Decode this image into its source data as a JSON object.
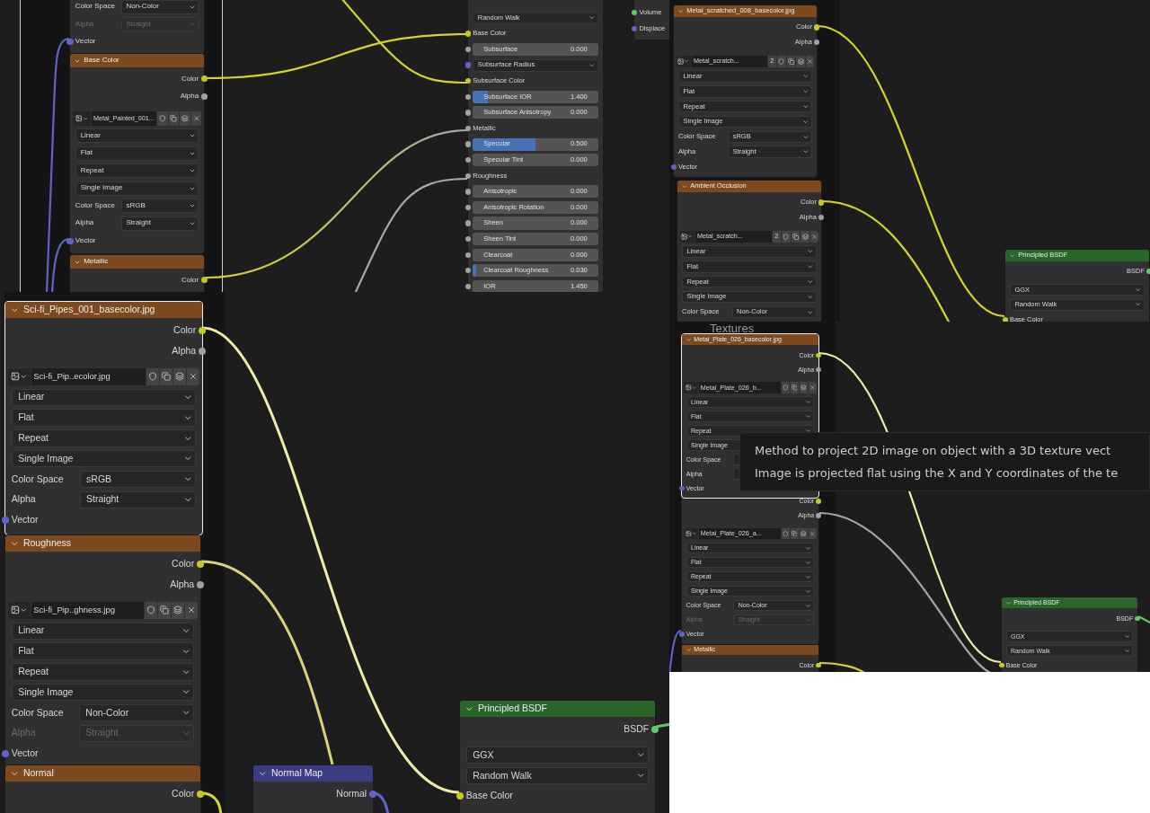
{
  "panels": [
    {
      "nodes": [
        {
          "kind": "texture",
          "selected": false,
          "rows": [
            {
              "kind": "prop",
              "label": "Color Space",
              "value": "Non-Color",
              "disabled": false
            },
            {
              "kind": "prop",
              "label": "Alpha",
              "value": "Straight",
              "disabled": true
            },
            {
              "kind": "input",
              "label": "Vector",
              "color": "#6363c7"
            }
          ]
        },
        {
          "title": "Base Color",
          "kind": "texture",
          "selected": false,
          "rows": [
            {
              "kind": "output",
              "label": "Color",
              "color": "#c7c729"
            },
            {
              "kind": "output",
              "label": "Alpha",
              "color": "#a1a1a1"
            },
            {
              "kind": "image",
              "file": "Metal_Painted_001..."
            },
            {
              "kind": "select",
              "value": "Linear"
            },
            {
              "kind": "select",
              "value": "Flat"
            },
            {
              "kind": "select",
              "value": "Repeat"
            },
            {
              "kind": "select",
              "value": "Single Image"
            },
            {
              "kind": "prop",
              "label": "Color Space",
              "value": "sRGB",
              "disabled": false
            },
            {
              "kind": "prop",
              "label": "Alpha",
              "value": "Straight",
              "disabled": false
            },
            {
              "kind": "input",
              "label": "Vector",
              "color": "#6363c7"
            }
          ]
        },
        {
          "title": "Metallic",
          "kind": "texture",
          "selected": false,
          "rows": [
            {
              "kind": "output",
              "label": "Color",
              "color": "#c7c729"
            }
          ]
        },
        {
          "kind": "shader",
          "selected": false,
          "rows": [
            {
              "kind": "select",
              "value": "Random Walk"
            },
            {
              "kind": "input",
              "label": "Base Color",
              "color": "#c7c729"
            },
            {
              "kind": "slider",
              "label": "Subsurface",
              "value": "0.000",
              "level": 0,
              "color": "#a1a1a1"
            },
            {
              "kind": "select",
              "value": "Subsurface Radius",
              "color": "#6363c7"
            },
            {
              "kind": "input",
              "label": "Subsurface Color",
              "color": "#c7c729"
            },
            {
              "kind": "slider",
              "label": "Subsurface IOR",
              "value": "1.400",
              "level": 0.12,
              "color": "#a1a1a1"
            },
            {
              "kind": "slider",
              "label": "Subsurface Anisotropy",
              "value": "0.000",
              "level": 0,
              "color": "#a1a1a1"
            },
            {
              "kind": "input",
              "label": "Metallic",
              "color": "#a1a1a1"
            },
            {
              "kind": "slider",
              "label": "Specular",
              "value": "0.500",
              "level": 0.5,
              "color": "#a1a1a1"
            },
            {
              "kind": "slider",
              "label": "Specular Tint",
              "value": "0.000",
              "level": 0,
              "color": "#a1a1a1"
            },
            {
              "kind": "input",
              "label": "Roughness",
              "color": "#a1a1a1"
            },
            {
              "kind": "slider",
              "label": "Anisotropic",
              "value": "0.000",
              "level": 0,
              "color": "#a1a1a1"
            },
            {
              "kind": "slider",
              "label": "Anisotropic Rotation",
              "value": "0.000",
              "level": 0,
              "color": "#a1a1a1"
            },
            {
              "kind": "slider",
              "label": "Sheen",
              "value": "0.000",
              "level": 0,
              "color": "#a1a1a1"
            },
            {
              "kind": "slider",
              "label": "Sheen Tint",
              "value": "0.000",
              "level": 0,
              "color": "#a1a1a1"
            },
            {
              "kind": "slider",
              "label": "Clearcoat",
              "value": "0.000",
              "level": 0,
              "color": "#a1a1a1"
            },
            {
              "kind": "slider",
              "label": "Clearcoat Roughness",
              "value": "0.030",
              "level": 0.03,
              "color": "#a1a1a1"
            },
            {
              "kind": "slider",
              "label": "IOR",
              "value": "1.450",
              "level": 0,
              "color": "#a1a1a1"
            }
          ]
        },
        {
          "kind": "output",
          "selected": false,
          "rows": [
            {
              "kind": "input",
              "label": "Volume",
              "color": "#63c763"
            },
            {
              "kind": "input",
              "label": "Displace",
              "color": "#6363c7"
            }
          ]
        }
      ]
    },
    {
      "nodes": [
        {
          "title": "Metal_scratched_008_basecolor.jpg",
          "kind": "texture",
          "selected": false,
          "rows": [
            {
              "kind": "output",
              "label": "Color",
              "color": "#c7c729"
            },
            {
              "kind": "output",
              "label": "Alpha",
              "color": "#a1a1a1"
            },
            {
              "kind": "image",
              "file": "Metal_scratch...",
              "users": "2"
            },
            {
              "kind": "select",
              "value": "Linear"
            },
            {
              "kind": "select",
              "value": "Flat"
            },
            {
              "kind": "select",
              "value": "Repeat"
            },
            {
              "kind": "select",
              "value": "Single Image"
            },
            {
              "kind": "prop",
              "label": "Color Space",
              "value": "sRGB",
              "disabled": false
            },
            {
              "kind": "prop",
              "label": "Alpha",
              "value": "Straight",
              "disabled": false
            },
            {
              "kind": "input",
              "label": "Vector",
              "color": "#6363c7"
            }
          ]
        },
        {
          "title": "Ambient Occlusion",
          "kind": "texture",
          "selected": false,
          "rows": [
            {
              "kind": "output",
              "label": "Color",
              "color": "#c7c729"
            },
            {
              "kind": "output",
              "label": "Alpha",
              "color": "#a1a1a1"
            },
            {
              "kind": "image",
              "file": "Metal_scratch...",
              "users": "2"
            },
            {
              "kind": "select",
              "value": "Linear"
            },
            {
              "kind": "select",
              "value": "Flat"
            },
            {
              "kind": "select",
              "value": "Repeat"
            },
            {
              "kind": "select",
              "value": "Single Image"
            },
            {
              "kind": "prop",
              "label": "Color Space",
              "value": "Non-Color",
              "disabled": false
            }
          ]
        },
        {
          "title": "Principled BSDF",
          "kind": "shader",
          "selected": false,
          "rows": [
            {
              "kind": "output",
              "label": "BSDF",
              "color": "#63c763"
            },
            {
              "kind": "select",
              "value": "GGX"
            },
            {
              "kind": "select",
              "value": "Random Walk"
            },
            {
              "kind": "input",
              "label": "Base Color",
              "color": "#c7c729"
            }
          ]
        }
      ]
    },
    {
      "nodes": [
        {
          "title": "Sci-fi_Pipes_001_basecolor.jpg",
          "kind": "texture",
          "selected": true,
          "rows": [
            {
              "kind": "output",
              "label": "Color",
              "color": "#c7c729"
            },
            {
              "kind": "output",
              "label": "Alpha",
              "color": "#a1a1a1"
            },
            {
              "kind": "image",
              "file": "Sci-fi_Pip..ecolor.jpg"
            },
            {
              "kind": "select",
              "value": "Linear"
            },
            {
              "kind": "select",
              "value": "Flat"
            },
            {
              "kind": "select",
              "value": "Repeat"
            },
            {
              "kind": "select",
              "value": "Single Image"
            },
            {
              "kind": "prop",
              "label": "Color Space",
              "value": "sRGB",
              "disabled": false
            },
            {
              "kind": "prop",
              "label": "Alpha",
              "value": "Straight",
              "disabled": false
            },
            {
              "kind": "input",
              "label": "Vector",
              "color": "#6363c7"
            }
          ]
        },
        {
          "title": "Roughness",
          "kind": "texture",
          "selected": false,
          "rows": [
            {
              "kind": "output",
              "label": "Color",
              "color": "#c7c729"
            },
            {
              "kind": "output",
              "label": "Alpha",
              "color": "#a1a1a1"
            },
            {
              "kind": "image",
              "file": "Sci-fi_Pip..ghness.jpg"
            },
            {
              "kind": "select",
              "value": "Linear"
            },
            {
              "kind": "select",
              "value": "Flat"
            },
            {
              "kind": "select",
              "value": "Repeat"
            },
            {
              "kind": "select",
              "value": "Single Image"
            },
            {
              "kind": "prop",
              "label": "Color Space",
              "value": "Non-Color",
              "disabled": false
            },
            {
              "kind": "prop",
              "label": "Alpha",
              "value": "Straight",
              "disabled": true
            },
            {
              "kind": "input",
              "label": "Vector",
              "color": "#6363c7"
            }
          ]
        },
        {
          "title": "Normal",
          "kind": "texture",
          "selected": false,
          "rows": [
            {
              "kind": "output",
              "label": "Color",
              "color": "#c7c729"
            }
          ]
        },
        {
          "title": "Normal Map",
          "kind": "vector",
          "selected": false,
          "rows": [
            {
              "kind": "output",
              "label": "Normal",
              "color": "#6363c7"
            }
          ]
        },
        {
          "title": "Principled BSDF",
          "kind": "shader",
          "selected": false,
          "rows": [
            {
              "kind": "output",
              "label": "BSDF",
              "color": "#63c763"
            },
            {
              "kind": "select",
              "value": "GGX"
            },
            {
              "kind": "select",
              "value": "Random Walk"
            },
            {
              "kind": "input",
              "label": "Base Color",
              "color": "#c7c729"
            }
          ]
        }
      ]
    },
    {
      "frame_label": "Textures",
      "nodes": [
        {
          "title": "Metal_Plate_026_basecolor.jpg",
          "kind": "texture",
          "selected": true,
          "rows": [
            {
              "kind": "output",
              "label": "Color",
              "color": "#c7c729"
            },
            {
              "kind": "output",
              "label": "Alpha",
              "color": "#a1a1a1"
            },
            {
              "kind": "image",
              "file": "Metal_Plate_026_b..."
            },
            {
              "kind": "select",
              "value": "Linear"
            },
            {
              "kind": "select",
              "value": "Flat"
            },
            {
              "kind": "select",
              "value": "Repeat"
            },
            {
              "kind": "select",
              "value": "Single Image"
            },
            {
              "kind": "prop",
              "label": "Color Space",
              "disabled": false
            },
            {
              "kind": "prop",
              "label": "Alpha",
              "disabled": false
            },
            {
              "kind": "input",
              "label": "Vector",
              "color": "#6363c7"
            }
          ]
        },
        {
          "kind": "texture",
          "selected": false,
          "rows": [
            {
              "kind": "output",
              "label": "Color",
              "color": "#c7c729"
            },
            {
              "kind": "output",
              "label": "Alpha",
              "color": "#a1a1a1"
            },
            {
              "kind": "image",
              "file": "Metal_Plate_026_a..."
            },
            {
              "kind": "select",
              "value": "Linear"
            },
            {
              "kind": "select",
              "value": "Flat"
            },
            {
              "kind": "select",
              "value": "Repeat"
            },
            {
              "kind": "select",
              "value": "Single Image"
            },
            {
              "kind": "prop",
              "label": "Color Space",
              "value": "Non-Color",
              "disabled": false
            },
            {
              "kind": "prop",
              "label": "Alpha",
              "value": "Straight",
              "disabled": true
            },
            {
              "kind": "input",
              "label": "Vector",
              "color": "#6363c7"
            }
          ]
        },
        {
          "title": "Metallic",
          "kind": "texture",
          "selected": false,
          "rows": [
            {
              "kind": "output",
              "label": "Color",
              "color": "#c7c729"
            }
          ]
        },
        {
          "title": "Principled BSDF",
          "kind": "shader",
          "selected": false,
          "rows": [
            {
              "kind": "output",
              "label": "BSDF",
              "color": "#63c763"
            },
            {
              "kind": "select",
              "value": "GGX"
            },
            {
              "kind": "select",
              "value": "Random Walk"
            },
            {
              "kind": "input",
              "label": "Base Color",
              "color": "#c7c729"
            }
          ]
        }
      ],
      "tooltip": [
        "Method to project 2D image on object with a 3D texture vect",
        "Image is projected flat using the X and Y coordinates of the te"
      ]
    }
  ]
}
